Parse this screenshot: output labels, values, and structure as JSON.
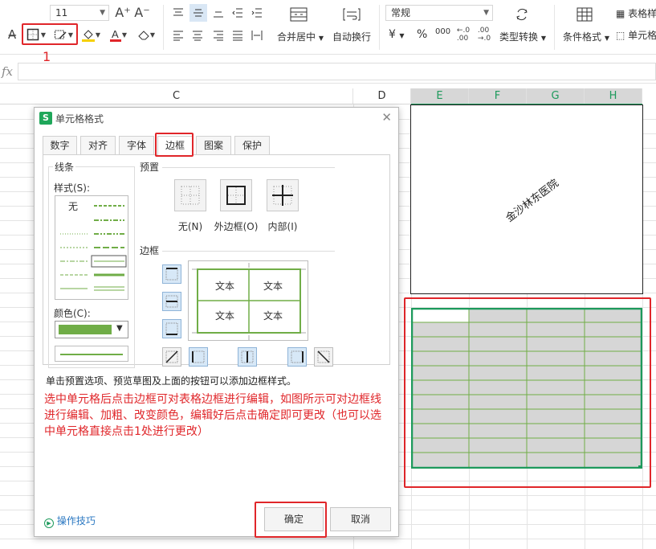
{
  "ribbon": {
    "font_size": "11",
    "font_size_up": "A⁺",
    "font_size_down": "A⁻",
    "merge_center": "合并居中",
    "wrap_text": "自动换行",
    "number_format": "常规",
    "currency": "¥",
    "percent": "%",
    "thousands": "000",
    "type_convert": "类型转换",
    "conditional_format": "条件格式",
    "table_style": "表格样",
    "cell_style": "单元格",
    "annotation_1": "1"
  },
  "formula_bar": {
    "fx": "fx",
    "value": ""
  },
  "sheet": {
    "columns": [
      "C",
      "D",
      "E",
      "F",
      "G",
      "H"
    ],
    "merged_cell_text": "金沙林东医院"
  },
  "dialog": {
    "title": "单元格格式",
    "close": "✕",
    "logo": "S",
    "tabs": [
      "数字",
      "对齐",
      "字体",
      "边框",
      "图案",
      "保护"
    ],
    "line_group": "线条",
    "style_label": "样式(S):",
    "style_none": "无",
    "color_label": "颜色(C):",
    "preset_group": "预置",
    "presets": [
      "无(N)",
      "外边框(O)",
      "内部(I)"
    ],
    "border_group": "边框",
    "preview_cells": [
      "文本",
      "文本",
      "文本",
      "文本"
    ],
    "hint": "单击预置选项、预览草图及上面的按钮可以添加边框样式。",
    "note": "选中单元格后点击边框可对表格边框进行编辑，如图所示可对边框线进行编辑、加粗、改变颜色，编辑好后点击确定即可更改（也可以选中单元格直接点击1处进行更改）",
    "tips": "操作技巧",
    "ok": "确定",
    "cancel": "取消"
  },
  "colors": {
    "accent_green": "#1d9a5c",
    "border_green": "#70ad47",
    "annotation_red": "#e0262a",
    "selected_fill": "#d7d7d7"
  }
}
